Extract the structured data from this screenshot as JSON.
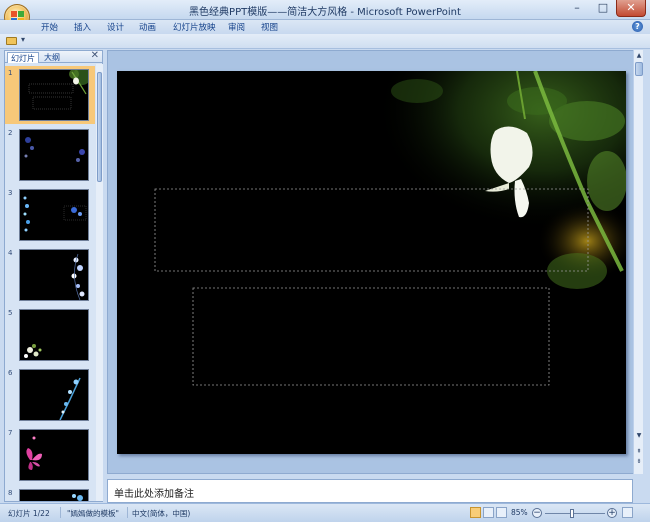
{
  "window": {
    "title": "黑色经典PPT模版——简洁大方风格 - Microsoft PowerPoint",
    "minimize": "–",
    "maximize": "□",
    "close": "✕"
  },
  "ribbon": {
    "tabs": [
      "开始",
      "插入",
      "设计",
      "动画",
      "幻灯片放映",
      "审阅",
      "视图"
    ],
    "help": "?"
  },
  "qat": {
    "arrow": "▾"
  },
  "panel": {
    "tabs": [
      "幻灯片",
      "大纲"
    ],
    "close": "✕",
    "slides": [
      {
        "num": "1",
        "selected": true
      },
      {
        "num": "2",
        "selected": false
      },
      {
        "num": "3",
        "selected": false
      },
      {
        "num": "4",
        "selected": false
      },
      {
        "num": "5",
        "selected": false
      },
      {
        "num": "6",
        "selected": false
      },
      {
        "num": "7",
        "selected": false
      },
      {
        "num": "8",
        "selected": false
      }
    ]
  },
  "notes": {
    "placeholder": "单击此处添加备注"
  },
  "statusbar": {
    "slide_info": "幻灯片 1/22",
    "theme": "\"嫣嫣做的模板\"",
    "language": "中文(简体，中国)",
    "zoom": "85%",
    "zoom_minus": "−",
    "zoom_plus": "+"
  },
  "colors": {
    "slide_background": "#000000",
    "selected_thumb": "#f7c879",
    "ribbon_text": "#15428b"
  }
}
